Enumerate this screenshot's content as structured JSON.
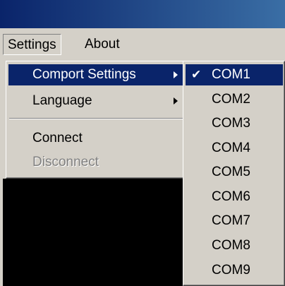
{
  "menubar": {
    "items": [
      {
        "label": "Settings"
      },
      {
        "label": "About"
      }
    ]
  },
  "settings_menu": {
    "items": [
      {
        "label": "Comport Settings",
        "has_submenu": true,
        "highlighted": true
      },
      {
        "label": "Language",
        "has_submenu": true
      },
      {
        "label": "Connect"
      },
      {
        "label": "Disconnect",
        "disabled": true
      }
    ]
  },
  "comport_submenu": {
    "check_glyph": "✔",
    "items": [
      {
        "label": "COM1",
        "checked": true,
        "highlighted": true
      },
      {
        "label": "COM2"
      },
      {
        "label": "COM3"
      },
      {
        "label": "COM4"
      },
      {
        "label": "COM5"
      },
      {
        "label": "COM6"
      },
      {
        "label": "COM7"
      },
      {
        "label": "COM8"
      },
      {
        "label": "COM9"
      }
    ]
  },
  "colors": {
    "menu_face": "#d4d0c8",
    "highlight": "#0a246a",
    "title_bar_start": "#0a246a",
    "title_bar_end": "#3a6ea5",
    "disabled_text": "#808080"
  }
}
